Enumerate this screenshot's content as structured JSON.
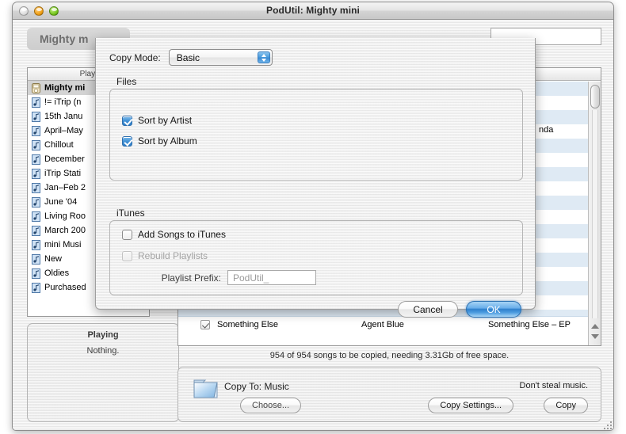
{
  "window": {
    "title": "PodUtil: Mighty mini",
    "lights": [
      "close-button",
      "minimize-button",
      "zoom-button"
    ]
  },
  "header": {
    "device_title": "Mighty m",
    "search_value": ""
  },
  "playlists": {
    "column_header": "Playl",
    "items": [
      {
        "label": "Mighty mi",
        "icon": "ipod-icon",
        "selected": true
      },
      {
        "label": "!= iTrip (n",
        "icon": "playlist-icon",
        "selected": false
      },
      {
        "label": "15th Janu",
        "icon": "playlist-icon",
        "selected": false
      },
      {
        "label": "April–May",
        "icon": "playlist-icon",
        "selected": false
      },
      {
        "label": "Chillout",
        "icon": "playlist-icon",
        "selected": false
      },
      {
        "label": "December",
        "icon": "playlist-icon",
        "selected": false
      },
      {
        "label": "iTrip Stati",
        "icon": "playlist-icon",
        "selected": false
      },
      {
        "label": "Jan–Feb 2",
        "icon": "playlist-icon",
        "selected": false
      },
      {
        "label": "June '04",
        "icon": "playlist-icon",
        "selected": false
      },
      {
        "label": "Living Roo",
        "icon": "playlist-icon",
        "selected": false
      },
      {
        "label": "March 200",
        "icon": "playlist-icon",
        "selected": false
      },
      {
        "label": "mini Musi",
        "icon": "playlist-icon",
        "selected": false
      },
      {
        "label": "New",
        "icon": "playlist-icon",
        "selected": false
      },
      {
        "label": "Oldies",
        "icon": "playlist-icon",
        "selected": false
      },
      {
        "label": "Purchased",
        "icon": "playlist-icon",
        "selected": false
      }
    ]
  },
  "playing": {
    "title": "Playing",
    "value": "Nothing."
  },
  "songs": {
    "partial_cell_text": "nda",
    "visible_row": {
      "checked": true,
      "name": "Something Else",
      "artist": "Agent Blue",
      "album": "Something Else – EP"
    }
  },
  "status": {
    "text": "954 of 954 songs to be copied, needing 3.31Gb of free space."
  },
  "copy_bar": {
    "folder_icon": "folder-icon",
    "copy_to_label": "Copy To: Music",
    "choose_label": "Choose...",
    "dont_steal": "Don't steal music.",
    "copy_settings_label": "Copy Settings...",
    "copy_label": "Copy"
  },
  "dialog": {
    "copy_mode_label": "Copy Mode:",
    "copy_mode_value": "Basic",
    "copy_mode_options": [
      "Basic"
    ],
    "files_group_label": "Files",
    "sort_by_artist": {
      "label": "Sort by Artist",
      "checked": true
    },
    "sort_by_album": {
      "label": "Sort by Album",
      "checked": true
    },
    "itunes_group_label": "iTunes",
    "add_songs": {
      "label": "Add Songs to iTunes",
      "checked": false
    },
    "rebuild_playlists": {
      "label": "Rebuild Playlists",
      "checked": false,
      "disabled": true
    },
    "playlist_prefix_label": "Playlist Prefix:",
    "playlist_prefix_value": "PodUtil_",
    "cancel_label": "Cancel",
    "ok_label": "OK"
  },
  "colors": {
    "accent_blue": "#3f8fd4",
    "ok_button_blue": "#2e80cc",
    "row_stripe_blue": "#dfeaf4",
    "window_gray": "#ececec"
  }
}
